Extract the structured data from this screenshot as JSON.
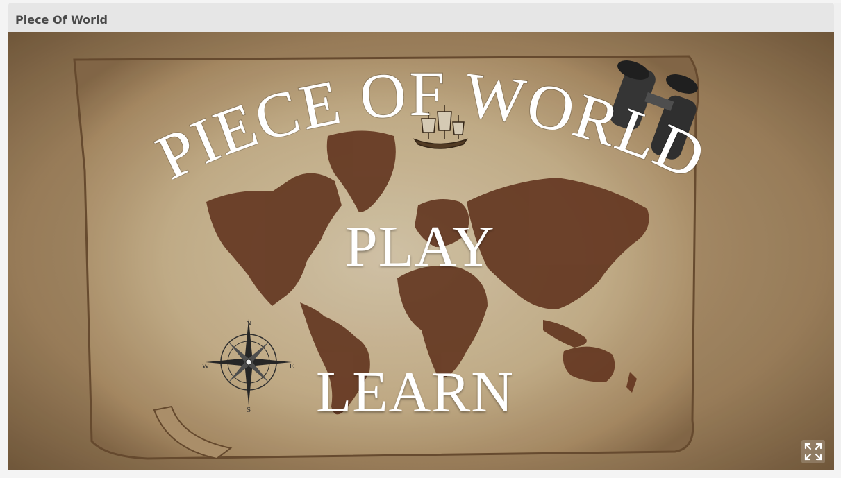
{
  "window": {
    "title": "Piece Of World"
  },
  "game": {
    "title": "PIECE OF WORLD",
    "menu": {
      "play_label": "PLAY",
      "learn_label": "LEARN"
    },
    "compass": {
      "north": "N",
      "south": "S",
      "east": "E",
      "west": "W"
    },
    "colors": {
      "parchment": "#d9c6a5",
      "parchment_dark": "#8d7152",
      "continents": "#6b3a22",
      "text": "#ffffff"
    }
  },
  "controls": {
    "fullscreen_icon": "fullscreen-expand-icon"
  }
}
